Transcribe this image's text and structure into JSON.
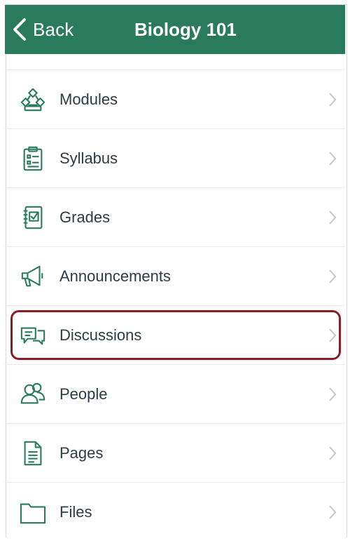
{
  "header": {
    "back_label": "Back",
    "title": "Biology 101",
    "color": "#2a7a5e"
  },
  "menu": {
    "items": [
      {
        "label": "Modules",
        "icon": "modules-icon"
      },
      {
        "label": "Syllabus",
        "icon": "syllabus-icon"
      },
      {
        "label": "Grades",
        "icon": "grades-icon"
      },
      {
        "label": "Announcements",
        "icon": "announcements-icon"
      },
      {
        "label": "Discussions",
        "icon": "discussions-icon",
        "highlighted": true
      },
      {
        "label": "People",
        "icon": "people-icon"
      },
      {
        "label": "Pages",
        "icon": "pages-icon"
      },
      {
        "label": "Files",
        "icon": "files-icon"
      }
    ],
    "highlight_color": "#8a1c24",
    "icon_color": "#2a7a5e"
  }
}
